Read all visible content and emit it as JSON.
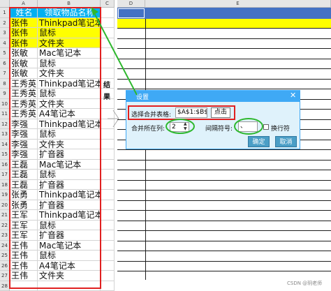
{
  "left_sheet": {
    "col_letters": [
      "A",
      "B",
      "C"
    ],
    "header": [
      "姓名",
      "领取物品名称"
    ],
    "row_numbers": [
      "1",
      "2",
      "3",
      "4",
      "5",
      "6",
      "7",
      "8",
      "9",
      "10",
      "11",
      "12",
      "13",
      "14",
      "15",
      "16",
      "17",
      "18",
      "19",
      "20",
      "21",
      "22",
      "23",
      "24",
      "25",
      "26",
      "27",
      "28"
    ],
    "rows": [
      [
        "张伟",
        "Thinkpad笔记本"
      ],
      [
        "张伟",
        "鼠标"
      ],
      [
        "张伟",
        "文件夹"
      ],
      [
        "张敏",
        "Mac笔记本"
      ],
      [
        "张敏",
        "鼠标"
      ],
      [
        "张敏",
        "文件夹"
      ],
      [
        "王秀英",
        "Thinkpad笔记本"
      ],
      [
        "王秀英",
        "鼠标"
      ],
      [
        "王秀英",
        "文件夹"
      ],
      [
        "王秀英",
        "A4笔记本"
      ],
      [
        "李强",
        "Thinkpad笔记本"
      ],
      [
        "李强",
        "鼠标"
      ],
      [
        "李强",
        "文件夹"
      ],
      [
        "李强",
        "扩音器"
      ],
      [
        "王磊",
        "Mac笔记本"
      ],
      [
        "王磊",
        "鼠标"
      ],
      [
        "王磊",
        "扩音器"
      ],
      [
        "张勇",
        "Thinkpad笔记本"
      ],
      [
        "张勇",
        "扩音器"
      ],
      [
        "王军",
        "Thinkpad笔记本"
      ],
      [
        "王军",
        "鼠标"
      ],
      [
        "王军",
        "扩音器"
      ],
      [
        "王伟",
        "Mac笔记本"
      ],
      [
        "王伟",
        "鼠标"
      ],
      [
        "王伟",
        "A4笔记本"
      ],
      [
        "王伟",
        "文件夹"
      ]
    ]
  },
  "result_label": "结果",
  "right_sheet": {
    "col_letters": [
      "D",
      "E"
    ]
  },
  "dialog": {
    "title": "设置",
    "range_label": "选择合并表格:",
    "range_value": "$A$1:$B$8",
    "pick_button": "点击",
    "column_label": "合并所在列:",
    "column_value": "2",
    "sep_label": "间隔符号:",
    "sep_value": "、",
    "newline_label": "换行符",
    "ok_button": "确定",
    "cancel_button": "取消"
  },
  "watermark": "CSDN @玥老师",
  "colors": {
    "header_blue": "#00b0f0",
    "highlight_yellow": "#ffff00",
    "selection_blue": "#4472c4",
    "annotation_red": "#e02020",
    "annotation_green": "#2eb82e",
    "dialog_bg": "#dff2fb",
    "dialog_title": "#3fa9f5"
  }
}
